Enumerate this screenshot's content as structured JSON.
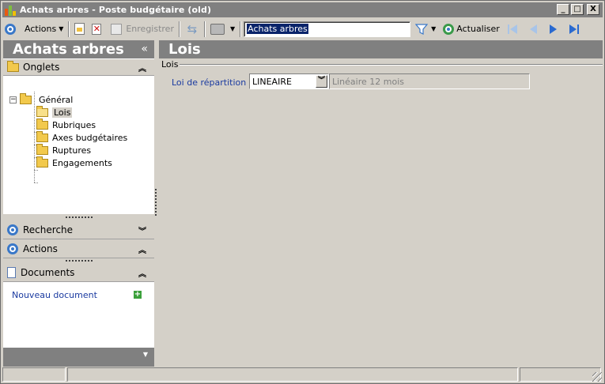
{
  "window": {
    "title": "Achats arbres -  Poste budgétaire (old)",
    "controls": {
      "minimize": "_",
      "maximize": "□",
      "close": "X"
    }
  },
  "toolbar": {
    "actions_label": "Actions",
    "save_label": "Enregistrer",
    "search_value": "Achats arbres",
    "refresh_label": "Actualiser"
  },
  "left_panel": {
    "title": "Achats arbres",
    "collapse_glyph": "«",
    "tabs_section": "Onglets",
    "tree": {
      "root": "Général",
      "children": [
        "Lois",
        "Rubriques",
        "Axes budgétaires",
        "Ruptures",
        "Engagements"
      ]
    },
    "sections": {
      "search": "Recherche",
      "actions": "Actions",
      "documents": "Documents"
    },
    "new_document": "Nouveau document"
  },
  "content": {
    "title": "Lois",
    "group_title": "Lois",
    "field_label": "Loi de répartition :",
    "field_value": "LINEAIRE",
    "field_description": "Linéaire 12 mois"
  },
  "colors": {
    "header_gray": "#808080",
    "window_bg": "#d4d0c8",
    "label_blue": "#1a3aa0",
    "selection_blue": "#0a246a"
  }
}
